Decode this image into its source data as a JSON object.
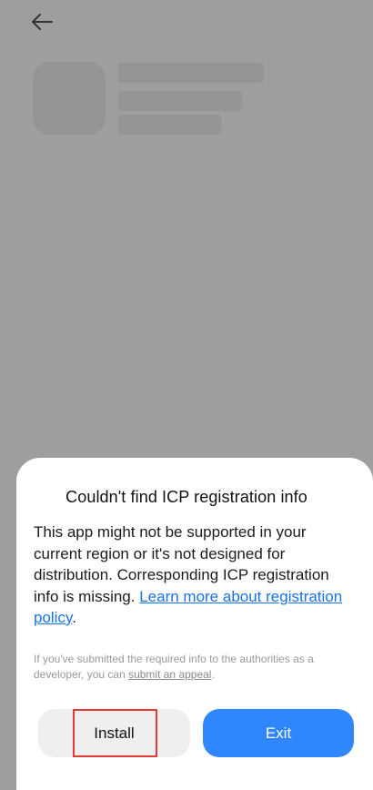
{
  "header": {
    "back_icon": "arrow-left-icon"
  },
  "dialog": {
    "title": "Couldn't find ICP registration info",
    "body_text": "This app might not be supported in your current region or it's not designed for distribution. Corresponding ICP registration info is missing. ",
    "body_link": "Learn more about registration policy",
    "body_end": ".",
    "note_text": "If you've submitted the required info to the authorities as a developer, you can ",
    "note_link": "submit an appeal",
    "note_end": ".",
    "install_label": "Install",
    "exit_label": "Exit"
  },
  "colors": {
    "accent": "#2f86ff",
    "link": "#1a73e8",
    "highlight": "#e53935",
    "backdrop": "#9e9e9e"
  }
}
